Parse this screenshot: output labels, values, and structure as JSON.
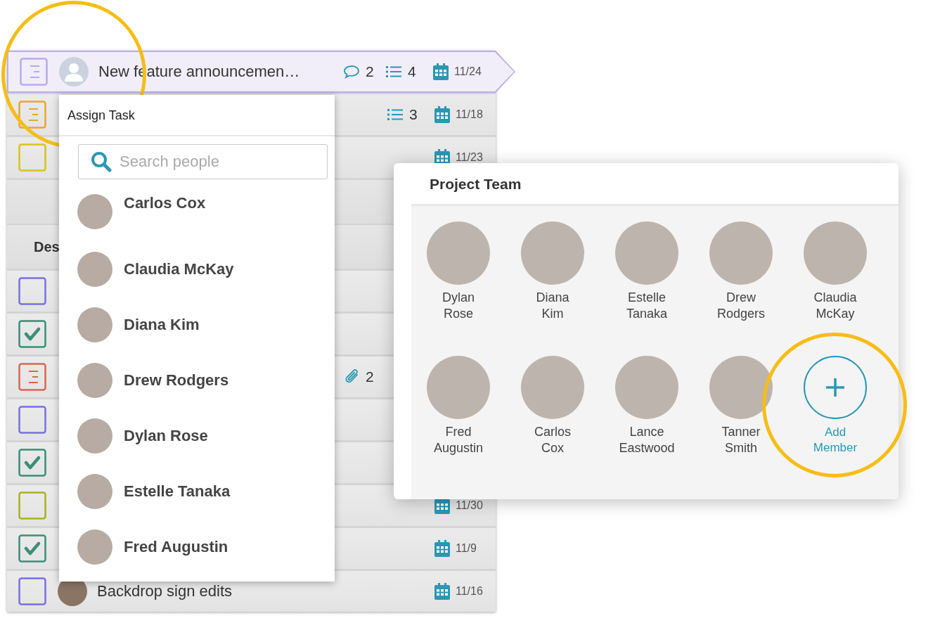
{
  "tasks_top": [
    {
      "kind": "note",
      "color": "#b9a9f0",
      "selected": true,
      "avatar": {
        "kind": "silhouette"
      },
      "title": "New feature announcemen…",
      "comments": "2",
      "subtasks": "4",
      "due": "11/24"
    },
    {
      "kind": "note",
      "color": "#e8a630",
      "selected": false,
      "subtasks": "3",
      "due": "11/18"
    },
    {
      "kind": "checkbox",
      "color": "#d9c21f",
      "checked": false,
      "selected": false,
      "due": "11/23"
    }
  ],
  "section": {
    "title": "Des"
  },
  "tasks": [
    {
      "kind": "checkbox",
      "color": "#7b6fe0",
      "checked": false,
      "selected": false
    },
    {
      "kind": "checkbox",
      "color": "#3a8f76",
      "checked": true,
      "selected": false
    },
    {
      "kind": "note",
      "color": "#d9674f",
      "selected": false,
      "attachments": "2"
    },
    {
      "kind": "checkbox",
      "color": "#7b6fe0",
      "checked": false,
      "selected": false
    },
    {
      "kind": "checkbox",
      "color": "#3a8f76",
      "checked": true,
      "selected": false
    },
    {
      "kind": "checkbox",
      "color": "#a8b21c",
      "checked": false,
      "selected": false,
      "due": "11/30"
    },
    {
      "kind": "checkbox",
      "color": "#3a8f76",
      "checked": true,
      "selected": false,
      "due": "11/9"
    },
    {
      "kind": "checkbox",
      "color": "#7b6fe0",
      "checked": false,
      "selected": false,
      "avatar": {
        "kind": "photo"
      },
      "title": "Backdrop sign edits",
      "due": "11/16"
    }
  ],
  "assign_popup": {
    "title": "Assign Task",
    "search": {
      "placeholder": "Search people"
    },
    "people": [
      "Carlos Cox",
      "Claudia McKay",
      "Diana Kim",
      "Drew Rodgers",
      "Dylan Rose",
      "Estelle Tanaka",
      "Fred Augustin"
    ]
  },
  "team_card": {
    "title": "Project Team",
    "members": [
      "Dylan Rose",
      "Diana Kim",
      "Estelle Tanaka",
      "Drew Rodgers",
      "Claudia McKay",
      "Fred Augustin",
      "Carlos Cox",
      "Lance Eastwood",
      "Tanner Smith"
    ],
    "add_button": "Add Member"
  }
}
